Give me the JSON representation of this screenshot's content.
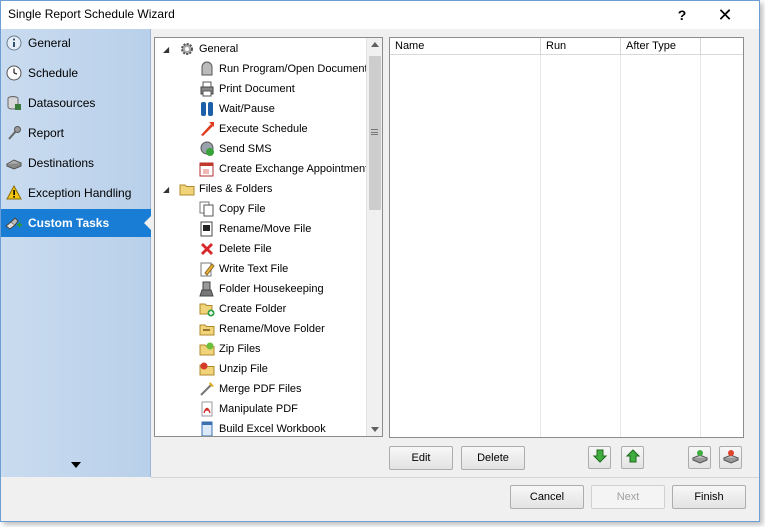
{
  "window": {
    "title": "Single Report Schedule Wizard",
    "help_label": "?",
    "close_label": "✕"
  },
  "sidebar": {
    "items": [
      {
        "label": "General",
        "icon": "info-icon"
      },
      {
        "label": "Schedule",
        "icon": "clock-icon"
      },
      {
        "label": "Datasources",
        "icon": "database-icon"
      },
      {
        "label": "Report",
        "icon": "report-pin-icon"
      },
      {
        "label": "Destinations",
        "icon": "printer-icon"
      },
      {
        "label": "Exception Handling",
        "icon": "warning-icon"
      },
      {
        "label": "Custom Tasks",
        "icon": "custom-tasks-icon",
        "active": true
      }
    ]
  },
  "tree": {
    "nodes": [
      {
        "label": "General",
        "level": 0,
        "expanded": true,
        "icon": "gear-icon"
      },
      {
        "label": "Run Program/Open Document",
        "level": 1,
        "icon": "run-program-icon"
      },
      {
        "label": "Print Document",
        "level": 1,
        "icon": "print-icon"
      },
      {
        "label": "Wait/Pause",
        "level": 1,
        "icon": "pause-icon"
      },
      {
        "label": "Execute Schedule",
        "level": 1,
        "icon": "execute-schedule-icon"
      },
      {
        "label": "Send SMS",
        "level": 1,
        "icon": "sms-icon"
      },
      {
        "label": "Create Exchange Appointment",
        "level": 1,
        "icon": "calendar-icon"
      },
      {
        "label": "Files & Folders",
        "level": 0,
        "expanded": true,
        "icon": "folder-icon"
      },
      {
        "label": "Copy File",
        "level": 1,
        "icon": "copy-file-icon"
      },
      {
        "label": "Rename/Move File",
        "level": 1,
        "icon": "rename-file-icon"
      },
      {
        "label": "Delete File",
        "level": 1,
        "icon": "delete-icon"
      },
      {
        "label": "Write Text File",
        "level": 1,
        "icon": "write-file-icon"
      },
      {
        "label": "Folder Housekeeping",
        "level": 1,
        "icon": "housekeeping-icon"
      },
      {
        "label": "Create Folder",
        "level": 1,
        "icon": "create-folder-icon"
      },
      {
        "label": "Rename/Move Folder",
        "level": 1,
        "icon": "rename-folder-icon"
      },
      {
        "label": "Zip Files",
        "level": 1,
        "icon": "zip-icon"
      },
      {
        "label": "Unzip File",
        "level": 1,
        "icon": "unzip-icon"
      },
      {
        "label": "Merge PDF Files",
        "level": 1,
        "icon": "merge-pdf-icon"
      },
      {
        "label": "Manipulate PDF",
        "level": 1,
        "icon": "pdf-icon"
      },
      {
        "label": "Build Excel Workbook",
        "level": 1,
        "icon": "excel-icon"
      }
    ]
  },
  "grid": {
    "columns": [
      "Name",
      "Run",
      "After Type",
      ""
    ],
    "rows": []
  },
  "actions": {
    "edit_label": "Edit",
    "delete_label": "Delete",
    "move_down": "arrow-down-icon",
    "move_up": "arrow-up-icon",
    "import": "import-icon",
    "export": "export-icon"
  },
  "footer": {
    "cancel_label": "Cancel",
    "next_label": "Next",
    "finish_label": "Finish"
  },
  "colors": {
    "sidebar_active": "#1a7dd5",
    "sidebar_bg": "#c9dbef"
  }
}
